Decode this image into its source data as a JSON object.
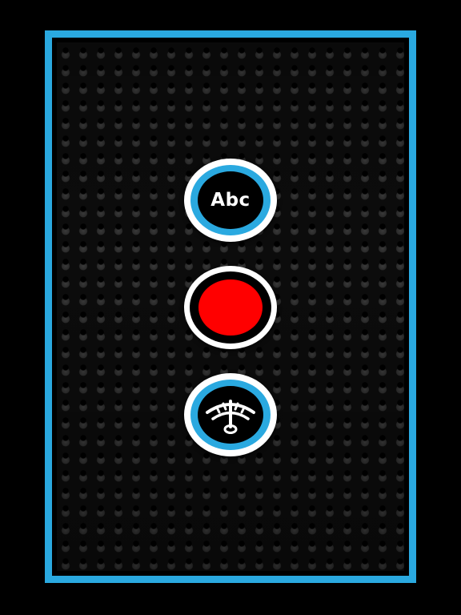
{
  "app": {
    "accent_color": "#2aa9e0",
    "record_color": "#ff0000"
  },
  "buttons": {
    "text_mode": {
      "label": "Abc",
      "icon": "text-abc-icon"
    },
    "record": {
      "icon": "record-dot-icon"
    },
    "meter": {
      "icon": "meter-gauge-icon"
    }
  }
}
